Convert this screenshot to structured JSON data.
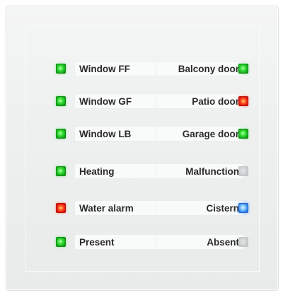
{
  "panel": {
    "rows": [
      {
        "left": {
          "label": "Window FF",
          "led": "green",
          "led_color": "#2fd32f"
        },
        "right": {
          "label": "Balcony door",
          "led": "green",
          "led_color": "#2fd32f"
        }
      },
      {
        "left": {
          "label": "Window GF",
          "led": "green",
          "led_color": "#2fd32f"
        },
        "right": {
          "label": "Patio door",
          "led": "red",
          "led_color": "#e8261a"
        }
      },
      {
        "left": {
          "label": "Window LB",
          "led": "green",
          "led_color": "#2fd32f"
        },
        "right": {
          "label": "Garage door",
          "led": "green",
          "led_color": "#2fd32f"
        }
      },
      {
        "left": {
          "label": "Heating",
          "led": "green",
          "led_color": "#2fd32f"
        },
        "right": {
          "label": "Malfunction",
          "led": "off",
          "led_color": "#c8cbcb"
        }
      },
      {
        "left": {
          "label": "Water alarm",
          "led": "red",
          "led_color": "#e8261a"
        },
        "right": {
          "label": "Cistern",
          "led": "blue",
          "led_color": "#3b8cf0"
        }
      },
      {
        "left": {
          "label": "Present",
          "led": "green",
          "led_color": "#2fd32f"
        },
        "right": {
          "label": "Absent",
          "led": "off",
          "led_color": "#c8cbcb"
        }
      }
    ]
  }
}
